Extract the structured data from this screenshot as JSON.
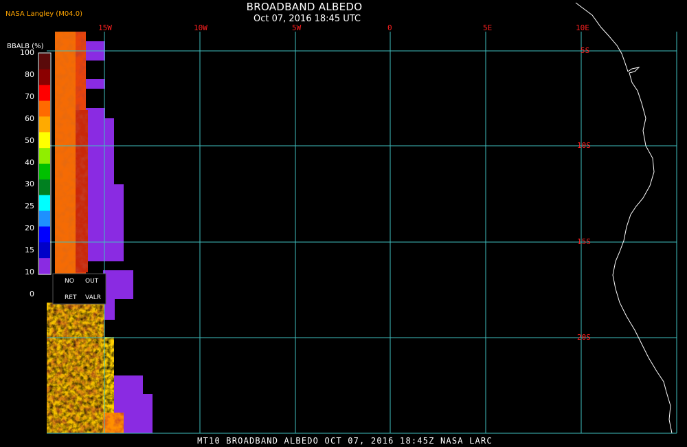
{
  "header": {
    "title": "BROADBAND ALBEDO",
    "datetime": "Oct 07, 2016 18:45 UTC",
    "credit": "NASA Langley (M04.0)"
  },
  "footer": {
    "text": "MT10  BROADBAND ALBEDO  OCT 07, 2016 18:45Z  NASA LARC"
  },
  "grid": {
    "longitudes": [
      "15W",
      "10W",
      "5W",
      "0",
      "5E",
      "10E"
    ],
    "latitudes": [
      "5S",
      "10S",
      "15S",
      "20S"
    ],
    "line_color": "#40c0c0",
    "label_color": "#ff2020"
  },
  "legend": {
    "title": "BBALB (%)",
    "ticks": [
      "100",
      "80",
      "70",
      "60",
      "50",
      "40",
      "30",
      "25",
      "20",
      "15",
      "10",
      "0"
    ],
    "colors": [
      "#5a0a0a",
      "#8b0000",
      "#ff0000",
      "#ff6a00",
      "#ffaa00",
      "#ffff00",
      "#90ee00",
      "#00c000",
      "#008020",
      "#00ffff",
      "#1e90ff",
      "#0000ff",
      "#0000c8",
      "#8a2be2"
    ],
    "no_retrieval": [
      "NO",
      "RET"
    ],
    "out_of_range": [
      "OUT",
      "VALR"
    ]
  },
  "colors": {
    "no_retrieval_fill": "#8a2be2",
    "coastline": "#ffffff",
    "background": "#000000"
  }
}
